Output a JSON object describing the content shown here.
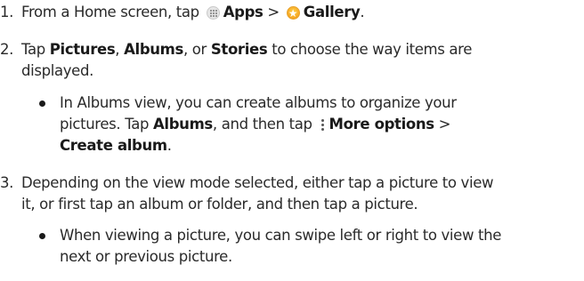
{
  "steps": [
    {
      "number": "1.",
      "t1": "From a Home screen, tap ",
      "apps": "Apps",
      "t2": " > ",
      "gallery": "Gallery",
      "t3": "."
    },
    {
      "number": "2.",
      "t1": "Tap ",
      "pictures": "Pictures",
      "t2": ", ",
      "albums": "Albums",
      "t3": ", or ",
      "stories": "Stories",
      "t4": " to choose the way items are",
      "line2": "displayed."
    },
    {
      "number": "3.",
      "line1": "Depending on the view mode selected, either tap a picture to view",
      "line2": "it, or first tap an album or folder, and then tap a picture."
    }
  ],
  "bullets": [
    {
      "line1": "In Albums view, you can create albums to organize your",
      "line2_t1": "pictures. Tap ",
      "line2_albums": "Albums",
      "line2_t2": ", and then tap ",
      "line2_more": "More options",
      "line2_t3": " >",
      "line3_bold": "Create album",
      "line3_t1": "."
    },
    {
      "line1": "When viewing a picture, you can swipe left or right to view the",
      "line2": "next or previous picture."
    }
  ],
  "icons": {
    "apps": "apps-grid-icon",
    "gallery": "gallery-star-icon",
    "more": "more-options-icon"
  }
}
